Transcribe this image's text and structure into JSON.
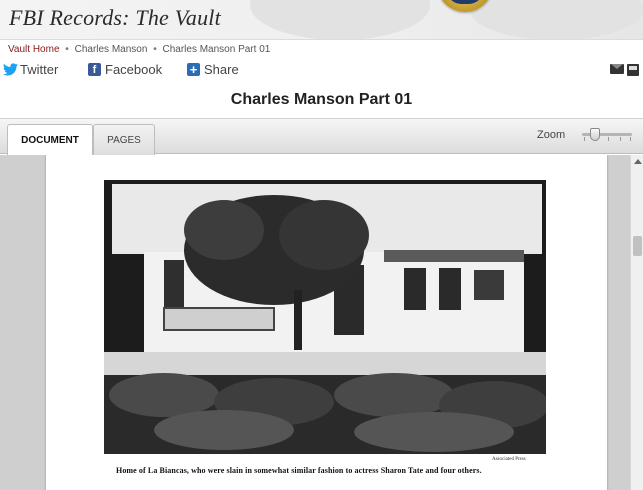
{
  "header": {
    "site_title": "FBI Records: The Vault"
  },
  "breadcrumb": {
    "items": [
      "Vault Home",
      "Charles Manson",
      "Charles Manson Part 01"
    ],
    "separator": "•"
  },
  "social": {
    "twitter_label": "Twitter",
    "facebook_label": "Facebook",
    "share_label": "Share",
    "twitter_icon": "twitter-bird-icon",
    "facebook_icon": "facebook-f-icon",
    "share_icon": "plus-share-icon",
    "tool_icons": [
      "mail-icon",
      "print-icon"
    ]
  },
  "document": {
    "title": "Charles Manson Part 01"
  },
  "toolbar": {
    "tabs": [
      {
        "label": "DOCUMENT",
        "active": true
      },
      {
        "label": "PAGES",
        "active": false
      }
    ],
    "zoom_label": "Zoom"
  },
  "page": {
    "photo_caption": "Home of La Biancas, who were slain in somewhat similar fashion to actress Sharon Tate and four others.",
    "photo_credit": "Associated Press"
  },
  "colors": {
    "breadcrumb_link": "#8b1a1a",
    "twitter_blue": "#1da1f2",
    "facebook_blue": "#3b5998",
    "share_blue": "#2a6db5",
    "viewer_background": "#cfcfcf"
  }
}
